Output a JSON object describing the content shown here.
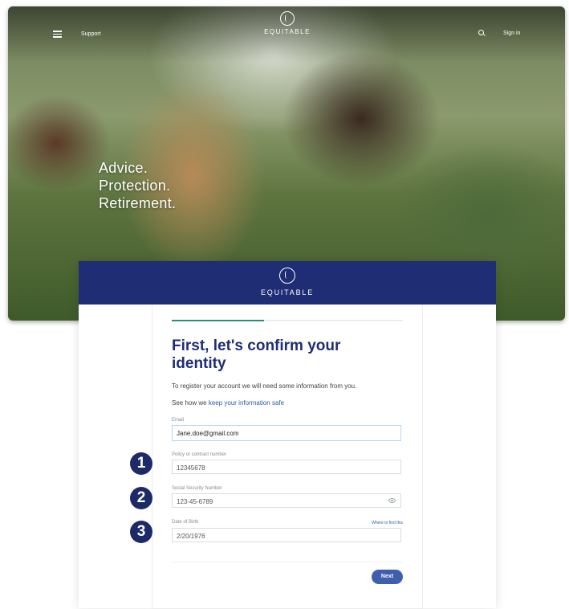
{
  "site": {
    "nav_support": "Support",
    "logo_text": "EQUITABLE",
    "sign_in": "Sign in",
    "hero_lines": [
      "Advice.",
      "Protection.",
      "Retirement."
    ]
  },
  "modal": {
    "logo_text": "EQUITABLE",
    "progress": 0.4,
    "title": "First, let's confirm your identity",
    "intro": "To register your account we will need some information from you.",
    "safe_prefix": "See how we ",
    "safe_link": "keep your information safe",
    "fields": {
      "email": {
        "label": "Email",
        "value": "Jane.doe@gmail.com"
      },
      "policy": {
        "label": "Policy or contract number",
        "value": "12345678",
        "help": "Where to find this"
      },
      "ssn": {
        "label": "Social Security Number",
        "value": "123-45-6789"
      },
      "dob": {
        "label": "Date of Birth",
        "value": "2/20/1976"
      }
    },
    "next_label": "Next"
  },
  "callouts": [
    "1",
    "2",
    "3"
  ],
  "colors": {
    "brand_navy": "#1f2d75",
    "progress_green": "#2e8b75",
    "button_blue": "#3f5fae",
    "badge": "#1c2a67"
  },
  "icons": [
    "menu-icon",
    "equitable-logo-icon",
    "search-icon",
    "eye-icon"
  ]
}
